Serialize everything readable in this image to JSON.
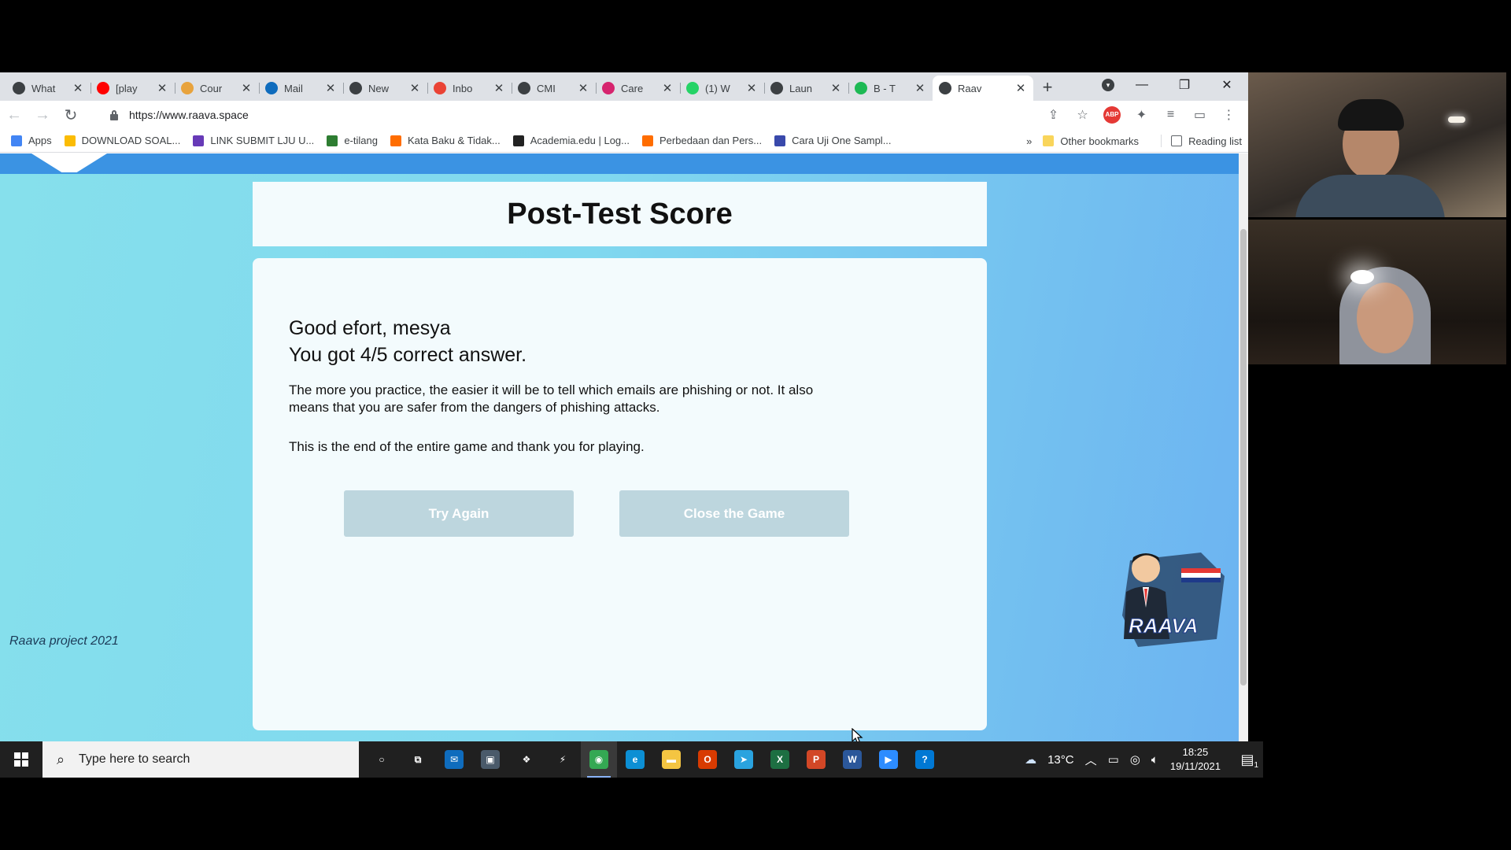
{
  "browser": {
    "tabs": [
      {
        "title": "What",
        "icon_color": "#3c4043",
        "icon": "globe-icon"
      },
      {
        "title": "[play",
        "icon_color": "#ff0000",
        "icon": "youtube-icon"
      },
      {
        "title": "Cour",
        "icon_color": "#e8a33d",
        "icon": "course-icon"
      },
      {
        "title": "Mail",
        "icon_color": "#0f6cbd",
        "icon": "outlook-icon"
      },
      {
        "title": "New",
        "icon_color": "#3c4043",
        "icon": "globe-icon"
      },
      {
        "title": "Inbo",
        "icon_color": "#ea4335",
        "icon": "gmail-icon"
      },
      {
        "title": "CMI",
        "icon_color": "#3c4043",
        "icon": "globe-icon"
      },
      {
        "title": "Care",
        "icon_color": "#d6246e",
        "icon": "career-icon"
      },
      {
        "title": "(1) W",
        "icon_color": "#25d366",
        "icon": "whatsapp-icon"
      },
      {
        "title": "Laun",
        "icon_color": "#3c4043",
        "icon": "globe-icon"
      },
      {
        "title": "B - T",
        "icon_color": "#1db954",
        "icon": "b-icon"
      },
      {
        "title": "Raav",
        "icon_color": "#3c4043",
        "icon": "globe-icon",
        "active": true
      }
    ],
    "url": "https://www.raava.space",
    "bookmarks": [
      {
        "label": "Apps",
        "icon_color": "#4285f4"
      },
      {
        "label": "DOWNLOAD SOAL...",
        "icon_color": "#fbbc04"
      },
      {
        "label": "LINK SUBMIT LJU U...",
        "icon_color": "#673ab7"
      },
      {
        "label": "e-tilang",
        "icon_color": "#2e7d32"
      },
      {
        "label": "Kata Baku & Tidak...",
        "icon_color": "#ff6d00"
      },
      {
        "label": "Academia.edu | Log...",
        "icon_color": "#222222"
      },
      {
        "label": "Perbedaan dan Pers...",
        "icon_color": "#ff6d00"
      },
      {
        "label": "Cara Uji One Sampl...",
        "icon_color": "#3949ab"
      }
    ],
    "bookmarks_overflow": "»",
    "other_bookmarks": "Other bookmarks",
    "reading_list": "Reading list"
  },
  "page": {
    "title": "Post-Test Score",
    "greeting_line1": "Good efort, mesya",
    "greeting_line2": "You got 4/5 correct answer.",
    "body": "The more you practice, the easier it will be to tell which emails are phishing or not. It also means that you are safer from the dangers of phishing attacks.",
    "ending": "This is the end of the entire game and thank you for playing.",
    "try_again": "Try Again",
    "close_game": "Close the Game",
    "footer": "Raava project 2021",
    "mascot_text": "RAAVA"
  },
  "taskbar": {
    "search_placeholder": "Type here to search",
    "weather": "13°C",
    "time": "18:25",
    "date": "19/11/2021",
    "notification_count": "1",
    "apps": [
      {
        "name": "cortana-icon",
        "color": "transparent",
        "glyph": "○"
      },
      {
        "name": "task-view-icon",
        "color": "transparent",
        "glyph": "⧉"
      },
      {
        "name": "mail-icon",
        "color": "#0f6cbd",
        "glyph": "✉"
      },
      {
        "name": "store-icon",
        "color": "#4a5a6a",
        "glyph": "▣"
      },
      {
        "name": "dropbox-icon",
        "color": "transparent",
        "glyph": "❖"
      },
      {
        "name": "vscode-icon",
        "color": "transparent",
        "glyph": "⚡"
      },
      {
        "name": "chrome-icon",
        "color": "#34a853",
        "glyph": "◉",
        "active": true
      },
      {
        "name": "edge-icon",
        "color": "#0c8fd4",
        "glyph": "e"
      },
      {
        "name": "explorer-icon",
        "color": "#f4c542",
        "glyph": "▬"
      },
      {
        "name": "office-icon",
        "color": "#d83b01",
        "glyph": "O"
      },
      {
        "name": "telegram-icon",
        "color": "#2aa3df",
        "glyph": "➤"
      },
      {
        "name": "excel-icon",
        "color": "#1d6f42",
        "glyph": "X"
      },
      {
        "name": "powerpoint-icon",
        "color": "#d24726",
        "glyph": "P"
      },
      {
        "name": "word-icon",
        "color": "#2b579a",
        "glyph": "W"
      },
      {
        "name": "zoom-icon",
        "color": "#2d8cff",
        "glyph": "▶"
      },
      {
        "name": "help-icon",
        "color": "#0078d4",
        "glyph": "?"
      }
    ]
  }
}
